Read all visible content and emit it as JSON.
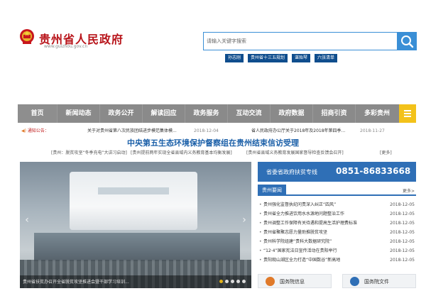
{
  "header": {
    "site_name": "贵州省人民政府",
    "site_url": "www.guizhou.gov.cn",
    "emblem_icon": "national-emblem-icon"
  },
  "search": {
    "placeholder": "请输入关键字搜索",
    "button_icon": "search-icon"
  },
  "hot_tags": [
    "孙志刚",
    "贵州省十三五规划",
    "谌贻琴",
    "六张清单"
  ],
  "nav": {
    "items": [
      "首页",
      "新闻动态",
      "政务公开",
      "解读回应",
      "政务服务",
      "互动交流",
      "政府数据",
      "招商引资",
      "多彩贵州"
    ],
    "menu_icon": "menu-icon"
  },
  "notice": {
    "label": "通知公告：",
    "items": [
      {
        "text": "关于对贵州省第八次民族团结进步模范集体模...",
        "date": "2018-12-04"
      },
      {
        "text": "省人民政府办公厅关于2018年及2018年第四季...",
        "date": "2018-11-27"
      }
    ]
  },
  "headline": "中央第五生态环境保护督察组在贵州结束信访受理",
  "sub_links": [
    "[贵州：脱贫攻坚“冬季充电”大讲习启动]",
    "[贵州提前两年实现全省县域内义务教育基本均衡发展]",
    "[贵州省县域义务教育发展国家督导检查反馈会召开]",
    "[更多]"
  ],
  "hero": {
    "caption": "贵州省扶贫办召开全省脱贫攻坚推进会暨干部学习培训...",
    "slide_count": 5
  },
  "hotline": {
    "label": "省委省政府扶贫专线",
    "number": "0851-86833668"
  },
  "news": {
    "title": "贵州要闻",
    "more": "更多>",
    "items": [
      {
        "text": "贵州强化监督执纪问责深入纠正“四风”",
        "date": "2018-12-05"
      },
      {
        "text": "贵州省全力推进饮用水水源地问题整治工作",
        "date": "2018-12-05"
      },
      {
        "text": "贵州调整工作保障有关待遇和提高生活护理费标准",
        "date": "2018-12-05"
      },
      {
        "text": "贵州省聚聚志愿力量助推脱贫攻坚",
        "date": "2018-12-05"
      },
      {
        "text": "贵州科学院组建“贵科大数据研究院”",
        "date": "2018-12-05"
      },
      {
        "text": "“12·4”国家宪法日宣传活动在贵阳举行",
        "date": "2018-12-05"
      },
      {
        "text": "贵阳观山湖区全力打造“中国数谷”新高地",
        "date": "2018-12-05"
      }
    ]
  },
  "doc_buttons": [
    {
      "label": "国务院信息",
      "icon": "document-icon"
    },
    {
      "label": "国务院文件",
      "icon": "file-icon"
    }
  ],
  "colors": {
    "brand_red": "#b8141a",
    "nav_grey": "#8a8a8a",
    "accent_blue": "#2f6fb6",
    "menu_yellow": "#f3c21a"
  }
}
